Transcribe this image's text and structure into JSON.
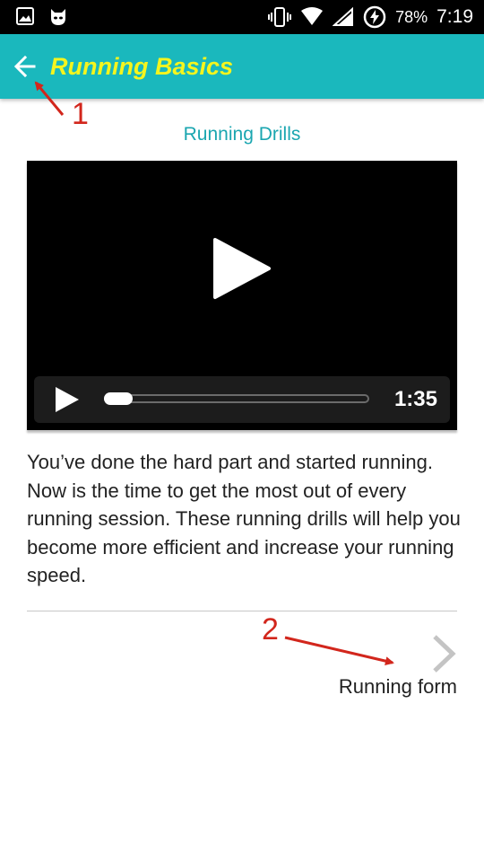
{
  "status_bar": {
    "battery_percent": "78%",
    "time": "7:19"
  },
  "app_bar": {
    "title": "Running Basics",
    "back_icon": "arrow-left-icon",
    "background_color": "#1ab8bd",
    "title_color": "#f5f51e"
  },
  "content": {
    "section_title": "Running Drills",
    "video": {
      "duration": "1:35",
      "progress_fraction": 0.0
    },
    "description": "You’ve done the hard part and started running. Now is the time to get the most out of every running session. These running drills will help you become more efficient and increase your running speed.",
    "next": {
      "label": "Running form",
      "icon": "chevron-right-icon"
    }
  },
  "annotations": {
    "marker_1": "1",
    "marker_2": "2",
    "color": "#d2261c"
  }
}
